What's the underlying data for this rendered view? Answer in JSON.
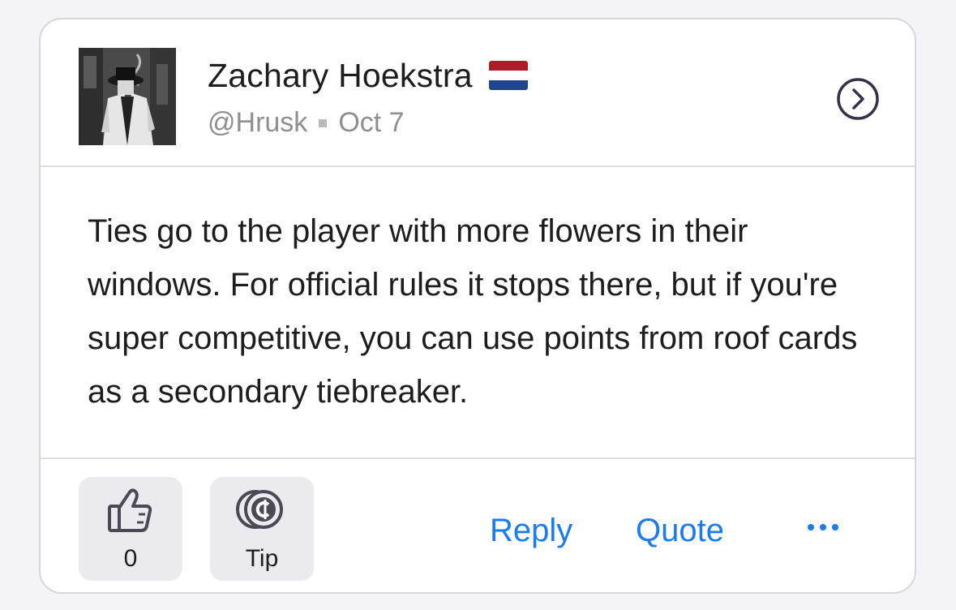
{
  "post": {
    "author": {
      "name": "Zachary Hoekstra",
      "handle": "@Hrusk",
      "date": "Oct 7",
      "flag": "netherlands-flag-icon",
      "flag_colors": [
        "#ae1c28",
        "#ffffff",
        "#21468b"
      ]
    },
    "body": "Ties go to the player with more flowers in their windows. For official rules it stops there, but if you're super competitive, you can use points from roof cards as a secondary tiebreaker.",
    "actions": {
      "like_count": "0",
      "tip_label": "Tip",
      "reply_label": "Reply",
      "quote_label": "Quote",
      "more_icon": "ellipsis-icon"
    },
    "nav_icon": "chevron-right-circle-icon"
  },
  "colors": {
    "accent": "#1a7cf0",
    "text": "#1d1d1f",
    "muted": "#8e8e93",
    "action_bg": "#ebebef",
    "icon_dark": "#333348"
  }
}
